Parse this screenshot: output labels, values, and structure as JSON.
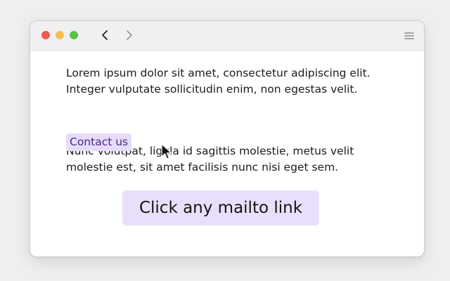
{
  "window": {
    "controls": [
      "close",
      "minimize",
      "zoom"
    ],
    "nav": {
      "back_icon": "chevron-left-icon",
      "forward_icon": "chevron-right-icon"
    },
    "menu_icon": "hamburger-menu-icon"
  },
  "content": {
    "paragraph1_line1": "Lorem ipsum dolor sit amet, consectetur adipiscing elit.",
    "paragraph1_line2": "Integer vulputate sollicitudin enim, non egestas velit.",
    "link_label": "Contact us",
    "paragraph2_line1": "Nunc volutpat,  ligula id sagittis molestie, metus velit",
    "paragraph2_line2": "molestie est, sit amet facilisis nunc nisi eget sem."
  },
  "callout": {
    "label": "Click any mailto link"
  },
  "colors": {
    "link_bg": "#e7dbfb",
    "link_text": "#4a2c7d",
    "callout_bg": "#eadffb",
    "close": "#ee5a52",
    "minimize": "#f5be4f",
    "zoom": "#5bc24b"
  }
}
